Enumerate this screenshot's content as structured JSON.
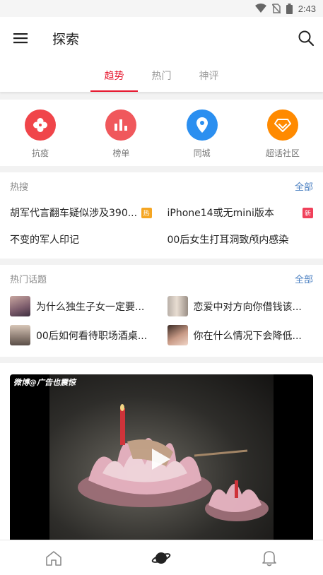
{
  "status": {
    "time": "2:43"
  },
  "header": {
    "title": "探索",
    "menu_icon": "menu-icon",
    "search_icon": "search-icon"
  },
  "tabs": [
    {
      "label": "趋势",
      "active": true
    },
    {
      "label": "热门",
      "active": false
    },
    {
      "label": "神评",
      "active": false
    }
  ],
  "quick_links": [
    {
      "label": "抗疫",
      "icon": "clover-icon",
      "color": "#f0454a"
    },
    {
      "label": "榜单",
      "icon": "bar-chart-icon",
      "color": "#f0585c"
    },
    {
      "label": "同城",
      "icon": "location-pin-icon",
      "color": "#2b8ff0"
    },
    {
      "label": "超话社区",
      "icon": "diamond-icon",
      "color": "#ff8a00"
    }
  ],
  "hot_search": {
    "title": "热搜",
    "all_label": "全部",
    "items": [
      {
        "text": "胡军代言翻车疑似涉及390...",
        "badge": "热"
      },
      {
        "text": "iPhone14或无mini版本",
        "badge": "新"
      },
      {
        "text": "不变的军人印记",
        "badge": ""
      },
      {
        "text": "00后女生打耳洞致颅内感染",
        "badge": ""
      }
    ]
  },
  "hot_topics": {
    "title": "热门话题",
    "all_label": "全部",
    "items": [
      {
        "text": "为什么独生子女一定要..."
      },
      {
        "text": "恋爱中对方向你借钱该..."
      },
      {
        "text": "00后如何看待职场酒桌..."
      },
      {
        "text": "你在什么情况下会降低..."
      }
    ]
  },
  "video": {
    "watermark": "微博@广告也震惊"
  },
  "bottom_nav": [
    {
      "icon": "home-icon"
    },
    {
      "icon": "planet-icon",
      "active": true
    },
    {
      "icon": "bell-icon"
    }
  ],
  "colors": {
    "accent": "#e6162d",
    "link": "#4a7fc1",
    "hot_badge": "#f5a623",
    "new_badge": "#f0405a"
  }
}
